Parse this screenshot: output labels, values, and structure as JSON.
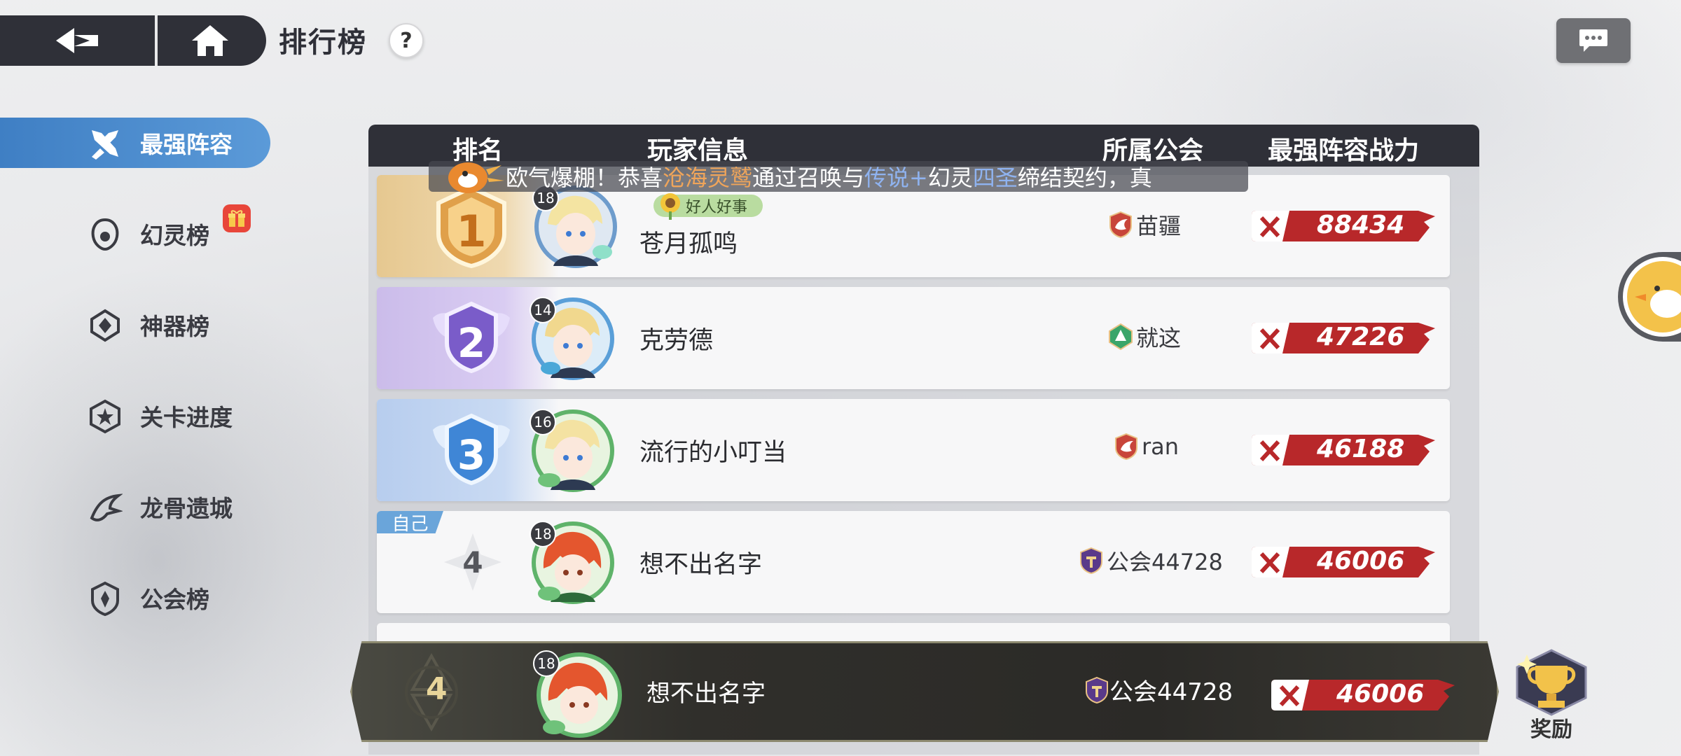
{
  "header": {
    "title": "排行榜",
    "help_label": "?"
  },
  "sidebar": {
    "items": [
      {
        "label": "最强阵容",
        "icon": "crossed-swords-icon",
        "active": true
      },
      {
        "label": "幻灵榜",
        "icon": "spirit-icon",
        "badge": "gift-icon"
      },
      {
        "label": "神器榜",
        "icon": "artifact-icon"
      },
      {
        "label": "关卡进度",
        "icon": "stage-icon"
      },
      {
        "label": "龙骨遗城",
        "icon": "dragon-bone-icon"
      },
      {
        "label": "公会榜",
        "icon": "guild-shield-icon"
      }
    ]
  },
  "table": {
    "columns": [
      "排名",
      "玩家信息",
      "所属公会",
      "最强阵容战力"
    ]
  },
  "banner": {
    "prefix": "欧气爆棚！恭喜",
    "player": "沧海灵鹫",
    "mid1": "通过召唤与",
    "rarity": "传说+",
    "mid2": "幻灵",
    "spirit": "四圣",
    "suffix": "缔结契约，真"
  },
  "rows": [
    {
      "rank": "1",
      "level": "18",
      "name": "苍月孤鸣",
      "tag": "好人好事",
      "guild": "苗疆",
      "power": "88434"
    },
    {
      "rank": "2",
      "level": "14",
      "name": "克劳德",
      "guild": "就这",
      "power": "47226"
    },
    {
      "rank": "3",
      "level": "16",
      "name": "流行的小叮当",
      "guild": "ran",
      "power": "46188"
    },
    {
      "rank": "4",
      "level": "18",
      "name": "想不出名字",
      "guild": "公会44728",
      "power": "46006",
      "self_tag": "自己"
    }
  ],
  "self": {
    "rank": "4",
    "level": "18",
    "name": "想不出名字",
    "guild": "公会44728",
    "power": "46006"
  },
  "reward": {
    "label": "奖励"
  },
  "colors": {
    "dark": "#2f3038",
    "accent_blue": "#3f7fc4",
    "power_red": "#b8282a",
    "gold": "#e0b467",
    "purple": "#b9a6e8",
    "light_blue": "#aac6ee"
  }
}
